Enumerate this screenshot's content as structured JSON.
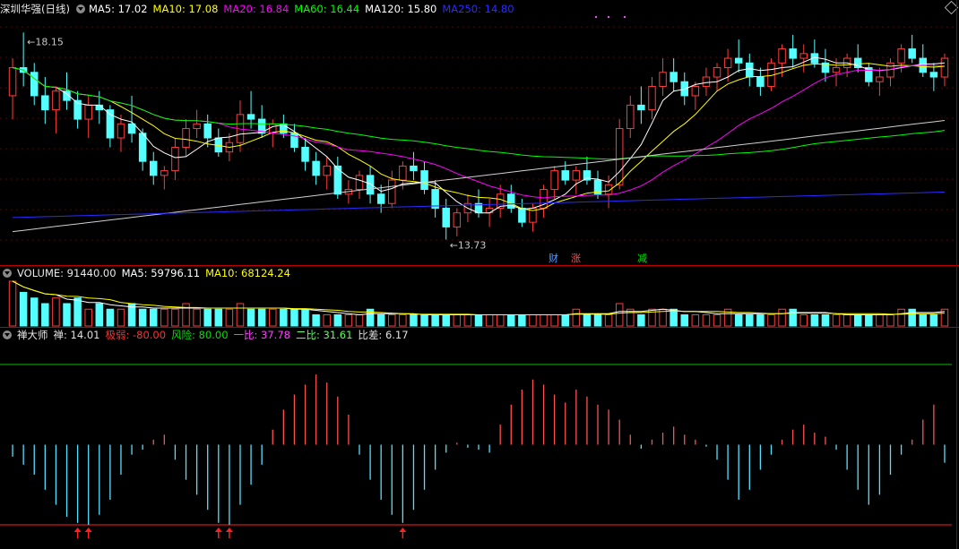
{
  "stock": {
    "name": "深圳华强(日线)",
    "ma": [
      {
        "label": "MA5: 17.02",
        "color": "#ffffff"
      },
      {
        "label": "MA10: 17.08",
        "color": "#ffff00"
      },
      {
        "label": "MA20: 16.84",
        "color": "#ff00ff"
      },
      {
        "label": "MA60: 16.44",
        "color": "#00ff00"
      },
      {
        "label": "MA120: 15.80",
        "color": "#ffffff"
      },
      {
        "label": "MA250: 14.80",
        "color": "#2b2bff"
      }
    ],
    "high_label": "18.15",
    "low_label": "13.73",
    "tags": [
      {
        "text": "财",
        "color": "#5b9bff"
      },
      {
        "text": "涨",
        "color": "#ff5050"
      },
      {
        "text": "减",
        "color": "#00e000"
      }
    ]
  },
  "volume": {
    "label": "VOLUME: 91440.00",
    "ma5": "MA5: 59796.11",
    "ma10": "MA10: 68124.24"
  },
  "indicator": {
    "name": "禅大师",
    "items": [
      {
        "label": "禅: 14.01",
        "color": "#e0e0e0"
      },
      {
        "label": "极弱: -80.00",
        "color": "#ff3030"
      },
      {
        "label": "风险: 80.00",
        "color": "#00e000"
      },
      {
        "label": "一比: 37.78",
        "color": "#ff40ff"
      },
      {
        "label": "二比: 31.61",
        "color": "#60ff60"
      },
      {
        "label": "比差: 6.17",
        "color": "#e0e0e0"
      }
    ]
  },
  "chart_data": {
    "type": "candlestick",
    "price_range": [
      13.3,
      18.5
    ],
    "ohlc": [
      [
        16.8,
        17.6,
        16.3,
        17.4
      ],
      [
        17.4,
        18.15,
        17.0,
        17.3
      ],
      [
        17.3,
        17.5,
        16.6,
        16.8
      ],
      [
        16.8,
        17.2,
        16.2,
        16.5
      ],
      [
        16.5,
        17.0,
        16.0,
        16.9
      ],
      [
        16.9,
        17.3,
        16.5,
        16.7
      ],
      [
        16.7,
        16.9,
        16.1,
        16.3
      ],
      [
        16.3,
        16.8,
        15.9,
        16.6
      ],
      [
        16.6,
        16.9,
        16.2,
        16.5
      ],
      [
        16.5,
        16.6,
        15.7,
        15.9
      ],
      [
        15.9,
        16.4,
        15.6,
        16.2
      ],
      [
        16.2,
        16.8,
        15.8,
        16.0
      ],
      [
        16.0,
        16.1,
        15.2,
        15.4
      ],
      [
        15.4,
        15.6,
        14.9,
        15.1
      ],
      [
        15.1,
        15.3,
        14.8,
        15.2
      ],
      [
        15.2,
        15.9,
        15.0,
        15.7
      ],
      [
        15.7,
        16.3,
        15.5,
        16.1
      ],
      [
        16.1,
        16.5,
        15.9,
        16.2
      ],
      [
        16.2,
        16.4,
        15.7,
        15.9
      ],
      [
        15.9,
        16.1,
        15.5,
        15.6
      ],
      [
        15.6,
        16.0,
        15.4,
        15.8
      ],
      [
        15.8,
        16.7,
        15.6,
        16.4
      ],
      [
        16.4,
        16.9,
        16.1,
        16.3
      ],
      [
        16.3,
        16.6,
        15.9,
        16.0
      ],
      [
        16.0,
        16.3,
        15.7,
        16.2
      ],
      [
        16.2,
        16.4,
        15.9,
        16.0
      ],
      [
        16.0,
        16.2,
        15.6,
        15.7
      ],
      [
        15.7,
        15.9,
        15.2,
        15.4
      ],
      [
        15.4,
        15.6,
        14.9,
        15.1
      ],
      [
        15.1,
        15.5,
        14.8,
        15.3
      ],
      [
        15.3,
        15.5,
        14.6,
        14.7
      ],
      [
        14.7,
        15.0,
        14.5,
        14.8
      ],
      [
        14.8,
        15.2,
        14.6,
        15.1
      ],
      [
        15.1,
        15.3,
        14.5,
        14.7
      ],
      [
        14.7,
        14.9,
        14.3,
        14.5
      ],
      [
        14.5,
        15.2,
        14.4,
        15.0
      ],
      [
        15.0,
        15.4,
        14.8,
        15.3
      ],
      [
        15.3,
        15.6,
        15.0,
        15.2
      ],
      [
        15.2,
        15.4,
        14.7,
        14.8
      ],
      [
        14.8,
        15.0,
        14.2,
        14.4
      ],
      [
        14.4,
        14.6,
        13.73,
        14.0
      ],
      [
        14.0,
        14.4,
        13.8,
        14.3
      ],
      [
        14.3,
        14.7,
        14.1,
        14.5
      ],
      [
        14.5,
        14.8,
        14.2,
        14.3
      ],
      [
        14.3,
        14.6,
        14.0,
        14.4
      ],
      [
        14.4,
        14.9,
        14.2,
        14.7
      ],
      [
        14.7,
        14.9,
        14.3,
        14.4
      ],
      [
        14.4,
        14.6,
        14.0,
        14.1
      ],
      [
        14.1,
        14.5,
        13.9,
        14.4
      ],
      [
        14.4,
        14.9,
        14.2,
        14.8
      ],
      [
        14.8,
        15.3,
        14.6,
        15.2
      ],
      [
        15.2,
        15.4,
        14.9,
        15.0
      ],
      [
        15.0,
        15.3,
        14.7,
        15.2
      ],
      [
        15.2,
        15.5,
        14.9,
        15.0
      ],
      [
        15.0,
        15.2,
        14.6,
        14.7
      ],
      [
        14.7,
        15.1,
        14.4,
        14.9
      ],
      [
        14.9,
        16.3,
        14.8,
        16.1
      ],
      [
        16.1,
        16.8,
        15.9,
        16.6
      ],
      [
        16.6,
        17.0,
        16.2,
        16.5
      ],
      [
        16.5,
        17.2,
        16.3,
        17.0
      ],
      [
        17.0,
        17.6,
        16.8,
        17.3
      ],
      [
        17.3,
        17.6,
        16.9,
        17.1
      ],
      [
        17.1,
        17.3,
        16.6,
        16.8
      ],
      [
        16.8,
        17.1,
        16.5,
        17.0
      ],
      [
        17.0,
        17.4,
        16.8,
        17.2
      ],
      [
        17.2,
        17.5,
        16.9,
        17.4
      ],
      [
        17.4,
        17.8,
        17.1,
        17.6
      ],
      [
        17.6,
        18.0,
        17.3,
        17.5
      ],
      [
        17.5,
        17.7,
        17.0,
        17.2
      ],
      [
        17.2,
        17.4,
        16.8,
        17.0
      ],
      [
        17.0,
        17.6,
        16.9,
        17.5
      ],
      [
        17.5,
        17.9,
        17.2,
        17.8
      ],
      [
        17.8,
        18.1,
        17.4,
        17.6
      ],
      [
        17.6,
        17.9,
        17.3,
        17.7
      ],
      [
        17.7,
        18.0,
        17.4,
        17.5
      ],
      [
        17.5,
        17.8,
        17.1,
        17.3
      ],
      [
        17.3,
        17.6,
        17.0,
        17.4
      ],
      [
        17.4,
        17.7,
        17.2,
        17.6
      ],
      [
        17.6,
        17.9,
        17.3,
        17.4
      ],
      [
        17.4,
        17.5,
        17.0,
        17.1
      ],
      [
        17.1,
        17.4,
        16.8,
        17.2
      ],
      [
        17.2,
        17.6,
        17.0,
        17.5
      ],
      [
        17.5,
        17.9,
        17.3,
        17.8
      ],
      [
        17.8,
        18.1,
        17.5,
        17.6
      ],
      [
        17.6,
        17.9,
        17.2,
        17.3
      ],
      [
        17.3,
        17.5,
        16.9,
        17.2
      ],
      [
        17.2,
        17.7,
        17.0,
        17.6
      ]
    ],
    "volume": [
      8,
      6,
      5,
      4,
      5,
      4,
      5,
      3,
      4,
      3,
      3,
      4,
      3,
      3,
      3,
      3,
      4,
      3,
      3,
      3,
      3,
      4,
      3,
      3,
      3,
      3,
      3,
      3,
      2,
      2,
      2,
      2,
      2,
      3,
      2,
      2,
      2,
      2,
      2,
      2,
      2,
      2,
      2,
      2,
      2,
      2,
      2,
      2,
      2,
      2,
      2,
      2,
      3,
      2,
      2,
      2,
      4,
      3,
      2,
      3,
      3,
      3,
      2,
      2,
      2,
      2,
      3,
      2,
      2,
      2,
      2,
      3,
      3,
      2,
      2,
      2,
      2,
      2,
      2,
      2,
      2,
      2,
      3,
      3,
      2,
      2,
      3
    ],
    "indicator_range": [
      -80,
      80
    ],
    "indicator": [
      -12,
      -20,
      -30,
      -45,
      -60,
      -72,
      -78,
      -80,
      -70,
      -55,
      -30,
      -10,
      -5,
      5,
      10,
      -15,
      -35,
      -50,
      -65,
      -78,
      -80,
      -60,
      -40,
      -20,
      15,
      35,
      50,
      60,
      70,
      62,
      48,
      30,
      -10,
      -35,
      -55,
      -70,
      -78,
      -65,
      -45,
      -25,
      -8,
      2,
      -3,
      -5,
      -8,
      20,
      40,
      55,
      65,
      60,
      50,
      42,
      55,
      48,
      40,
      35,
      25,
      10,
      -4,
      5,
      12,
      18,
      10,
      5,
      -2,
      -15,
      -35,
      -55,
      -45,
      -25,
      -10,
      5,
      15,
      20,
      12,
      8,
      -5,
      -25,
      -45,
      -60,
      -50,
      -30,
      -10,
      5,
      25,
      40,
      -18
    ]
  }
}
